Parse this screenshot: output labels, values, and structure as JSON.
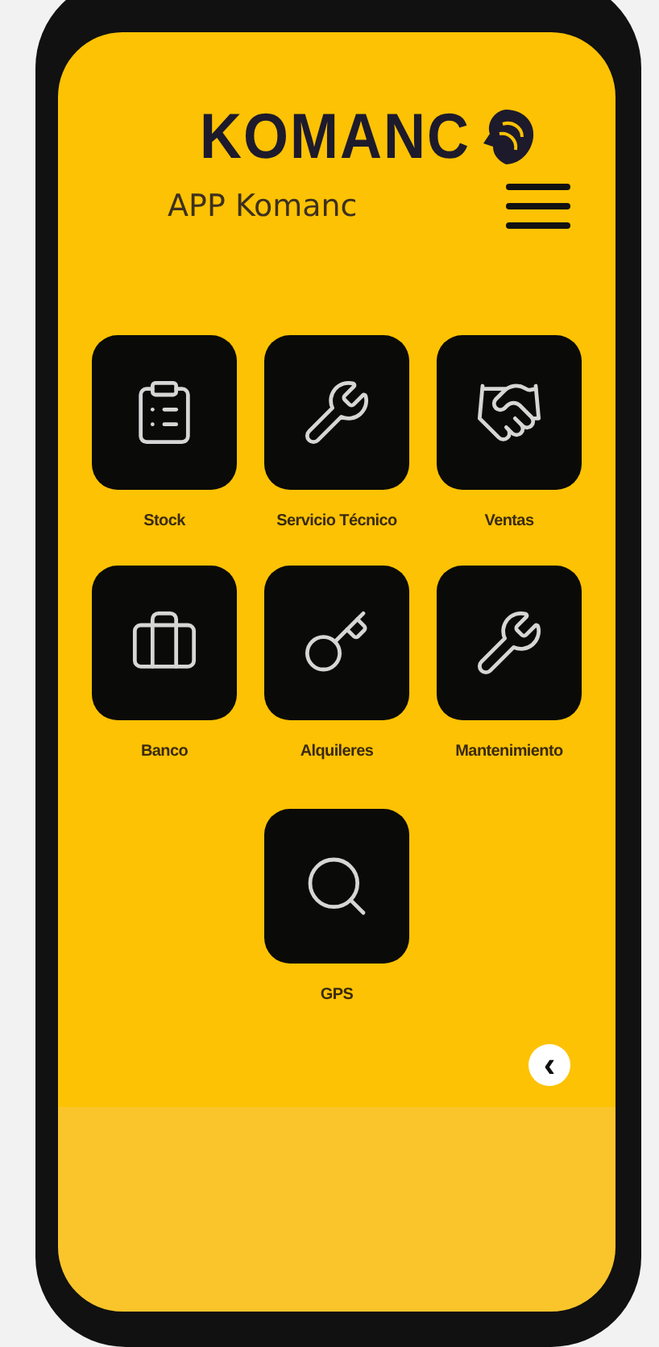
{
  "header": {
    "logo": "KOMANC",
    "title": "APP Komanc"
  },
  "menu": [
    {
      "label": "Stock"
    },
    {
      "label": "Servicio Técnico"
    },
    {
      "label": "Ventas"
    },
    {
      "label": "Banco"
    },
    {
      "label": "Alquileres"
    },
    {
      "label": "Mantenimiento"
    },
    {
      "label": "GPS"
    }
  ],
  "back_button": {
    "label": "‹"
  }
}
